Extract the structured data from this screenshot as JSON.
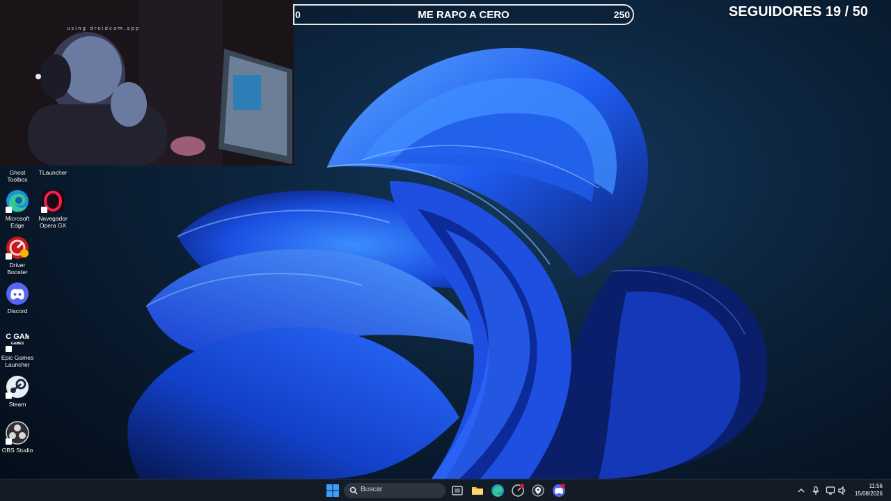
{
  "overlay": {
    "webcam_watermark": "using droidcam.app",
    "goal": {
      "min": "0",
      "title": "ME RAPO A CERO",
      "max": "250",
      "progress": 0
    },
    "followers": "SEGUIDORES 19 / 50"
  },
  "desktop": {
    "icons": [
      {
        "label": "Ghost Toolbox",
        "icon": "ghost-toolbox-icon"
      },
      {
        "label": "TLauncher",
        "icon": "tlauncher-icon"
      },
      {
        "label": "Microsoft Edge",
        "icon": "edge-icon"
      },
      {
        "label": "Navegador Opera GX",
        "icon": "opera-gx-icon"
      },
      {
        "label": "Driver Booster",
        "icon": "driver-booster-icon"
      },
      {
        "label": "Discord",
        "icon": "discord-icon"
      },
      {
        "label": "Epic Games Launcher",
        "icon": "epic-games-icon",
        "logo_text": "EPIC GAMES"
      },
      {
        "label": "Steam",
        "icon": "steam-icon"
      },
      {
        "label": "OBS Studio",
        "icon": "obs-icon"
      }
    ]
  },
  "taskbar": {
    "search_placeholder": "Buscar",
    "pinned": [
      "start-icon",
      "task-view-icon",
      "file-explorer-icon",
      "edge-icon",
      "driver-booster-icon",
      "gps-icon",
      "discord-icon"
    ],
    "clock": {
      "time": "11:56",
      "date": "15/08/2026"
    }
  },
  "colors": {
    "accent": "#2a6bff",
    "taskbar": "#141c26"
  }
}
